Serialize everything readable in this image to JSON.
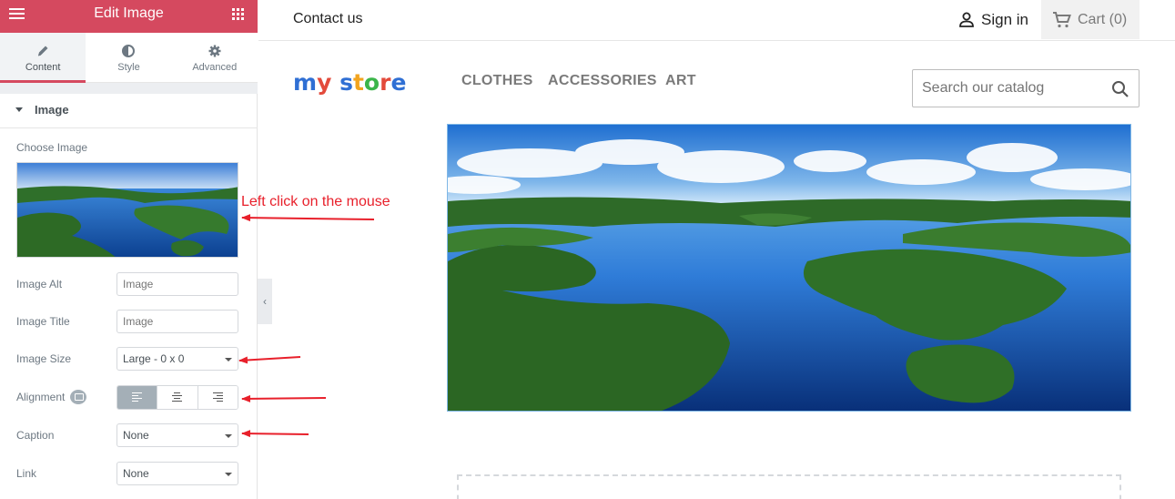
{
  "editor": {
    "header_title": "Edit Image",
    "tabs": [
      {
        "label": "Content",
        "icon": "pencil-icon"
      },
      {
        "label": "Style",
        "icon": "contrast-icon"
      },
      {
        "label": "Advanced",
        "icon": "gear-icon"
      }
    ],
    "section_title": "Image",
    "choose_image_label": "Choose Image",
    "image_alt": {
      "label": "Image Alt",
      "placeholder": "Image"
    },
    "image_title": {
      "label": "Image Title",
      "placeholder": "Image"
    },
    "image_size": {
      "label": "Image Size",
      "value": "Large - 0 x 0"
    },
    "alignment": {
      "label": "Alignment",
      "options": [
        "left",
        "center",
        "right"
      ],
      "selected": "left"
    },
    "caption": {
      "label": "Caption",
      "value": "None"
    },
    "link": {
      "label": "Link",
      "value": "None"
    },
    "collapse_glyph": "‹"
  },
  "annotation": {
    "text": "Left click on the mouse",
    "color": "#e8202b"
  },
  "store": {
    "contact": "Contact us",
    "sign_in": "Sign in",
    "cart": "Cart (0)",
    "logo_letters": [
      {
        "ch": "m",
        "color": "#2f6fd4"
      },
      {
        "ch": "y",
        "color": "#e34a3b"
      },
      {
        "ch": " ",
        "color": "#ffffff"
      },
      {
        "ch": "s",
        "color": "#2f6fd4"
      },
      {
        "ch": "t",
        "color": "#f2a41f"
      },
      {
        "ch": "o",
        "color": "#3bb54a"
      },
      {
        "ch": "r",
        "color": "#e34a3b"
      },
      {
        "ch": "e",
        "color": "#2f6fd4"
      }
    ],
    "nav": [
      "CLOTHES",
      "ACCESSORIES",
      "ART"
    ],
    "search_placeholder": "Search our catalog"
  },
  "colors": {
    "accent": "#d5495f",
    "annotation": "#e8202b"
  }
}
